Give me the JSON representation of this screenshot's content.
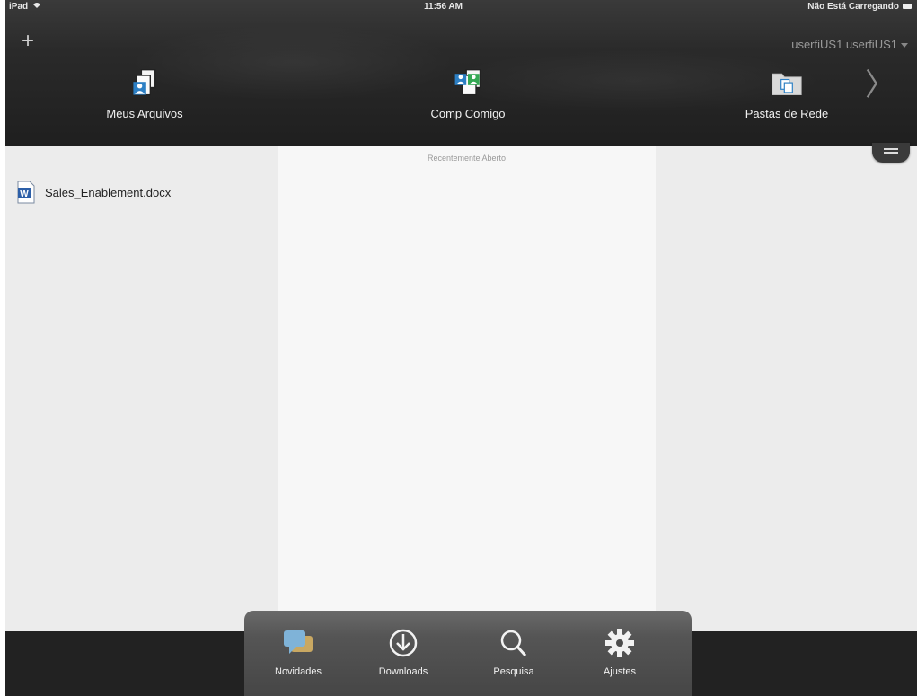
{
  "status_bar": {
    "device": "iPad",
    "time": "11:56 AM",
    "battery_text": "Não Está Carregando"
  },
  "header": {
    "add_icon": "plus-icon",
    "user": "userfiUS1 userfiUS1",
    "nav": [
      {
        "label": "Meus Arquivos",
        "icon": "my-files-icon"
      },
      {
        "label": "Comp Comigo",
        "icon": "shared-with-me-icon"
      },
      {
        "label": "Pastas de Rede",
        "icon": "network-folders-icon"
      }
    ]
  },
  "main": {
    "recent_caption": "Recentemente Aberto",
    "files": [
      {
        "name": "Sales_Enablement.docx",
        "icon": "word-document-icon"
      }
    ]
  },
  "dock": {
    "items": [
      {
        "label": "Novidades",
        "icon": "news-chat-icon"
      },
      {
        "label": "Downloads",
        "icon": "download-icon"
      },
      {
        "label": "Pesquisa",
        "icon": "search-icon"
      },
      {
        "label": "Ajustes",
        "icon": "gear-icon"
      }
    ]
  },
  "colors": {
    "header_bg": "#262626",
    "panel_bg": "#ececec",
    "center_bg": "#f7f7f7",
    "accent_blue": "#2c7fc4",
    "accent_green": "#34a853"
  }
}
